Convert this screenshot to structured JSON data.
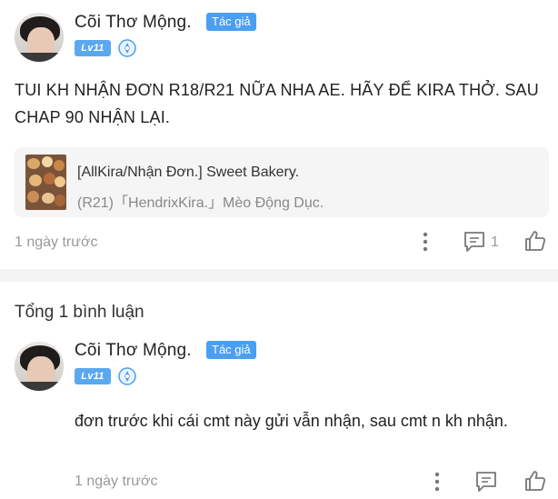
{
  "post": {
    "author_name": "Cõi Thơ Mộng.",
    "author_badge": "Tác giả",
    "level": "Lv11",
    "text": "TUI KH NHẬN ĐƠN R18/R21 NỮA NHA AE. HÃY ĐỂ KIRA THỞ. SAU CHAP 90 NHẬN LẠI.",
    "story": {
      "title": "[AllKira/Nhận Đơn.] Sweet Bakery.",
      "subtitle": "(R21)「HendrixKira.」Mèo Động Dục."
    },
    "time": "1 ngày trước",
    "comment_count": "1"
  },
  "comments": {
    "total_label": "Tổng 1 bình luận",
    "items": [
      {
        "author_name": "Cõi Thơ Mộng.",
        "author_badge": "Tác giả",
        "level": "Lv11",
        "text": "đơn trước khi cái cmt này gửi vẫn nhận, sau cmt n kh nhận.",
        "time": "1 ngày trước"
      }
    ]
  },
  "colors": {
    "accent_badge": "#4a9ff0",
    "level_badge": "#5aa8f0",
    "muted_text": "#999999",
    "card_bg": "#f5f5f5"
  },
  "icons": [
    "more-vertical-icon",
    "comment-icon",
    "like-icon",
    "medal-icon"
  ]
}
